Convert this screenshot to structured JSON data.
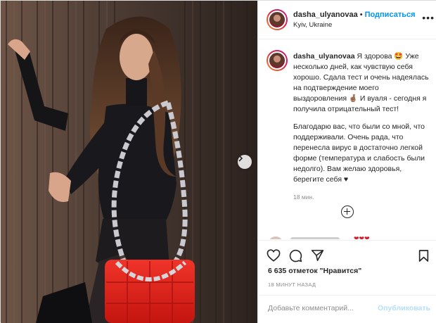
{
  "post": {
    "author": {
      "username": "dasha_ulyanovaa",
      "location": "Kyiv, Ukraine"
    },
    "header": {
      "separator": "•",
      "follow_label": "Подписаться",
      "more_icon": "more-options-icon"
    },
    "caption": {
      "username": "dasha_ulyanovaa",
      "paragraph1": "Я здорова 🤩 Уже несколько дней, как чувствую себя хорошо. Сдала тест и очень надеялась на подтверждение моего выздоровления 🤞🏽 И вуаля - сегодня я получила отрицательный тест!",
      "paragraph2": "Благодарю вас, что были со мной, что поддерживали. Очень рада, что перенесла вирус в достаточно легкой форме (температура и слабость были недолго). Вам желаю здоровья, берегите себя ♥",
      "time_ago": "18 мин."
    },
    "peek_comment": {
      "hearts": "❤❤❤"
    },
    "actions": {
      "like_icon": "heart-icon",
      "comment_icon": "comment-icon",
      "share_icon": "share-icon",
      "save_icon": "bookmark-icon"
    },
    "likes_text": "6 635 отметок \"Нравится\"",
    "timestamp": "18 МИНУТ НАЗАД",
    "comment_form": {
      "placeholder": "Добавьте комментарий...",
      "submit_label": "Опубликовать"
    }
  },
  "colors": {
    "accent": "#0095f6",
    "submit_disabled": "#b2dffc",
    "bag_red": "#e0221c"
  }
}
